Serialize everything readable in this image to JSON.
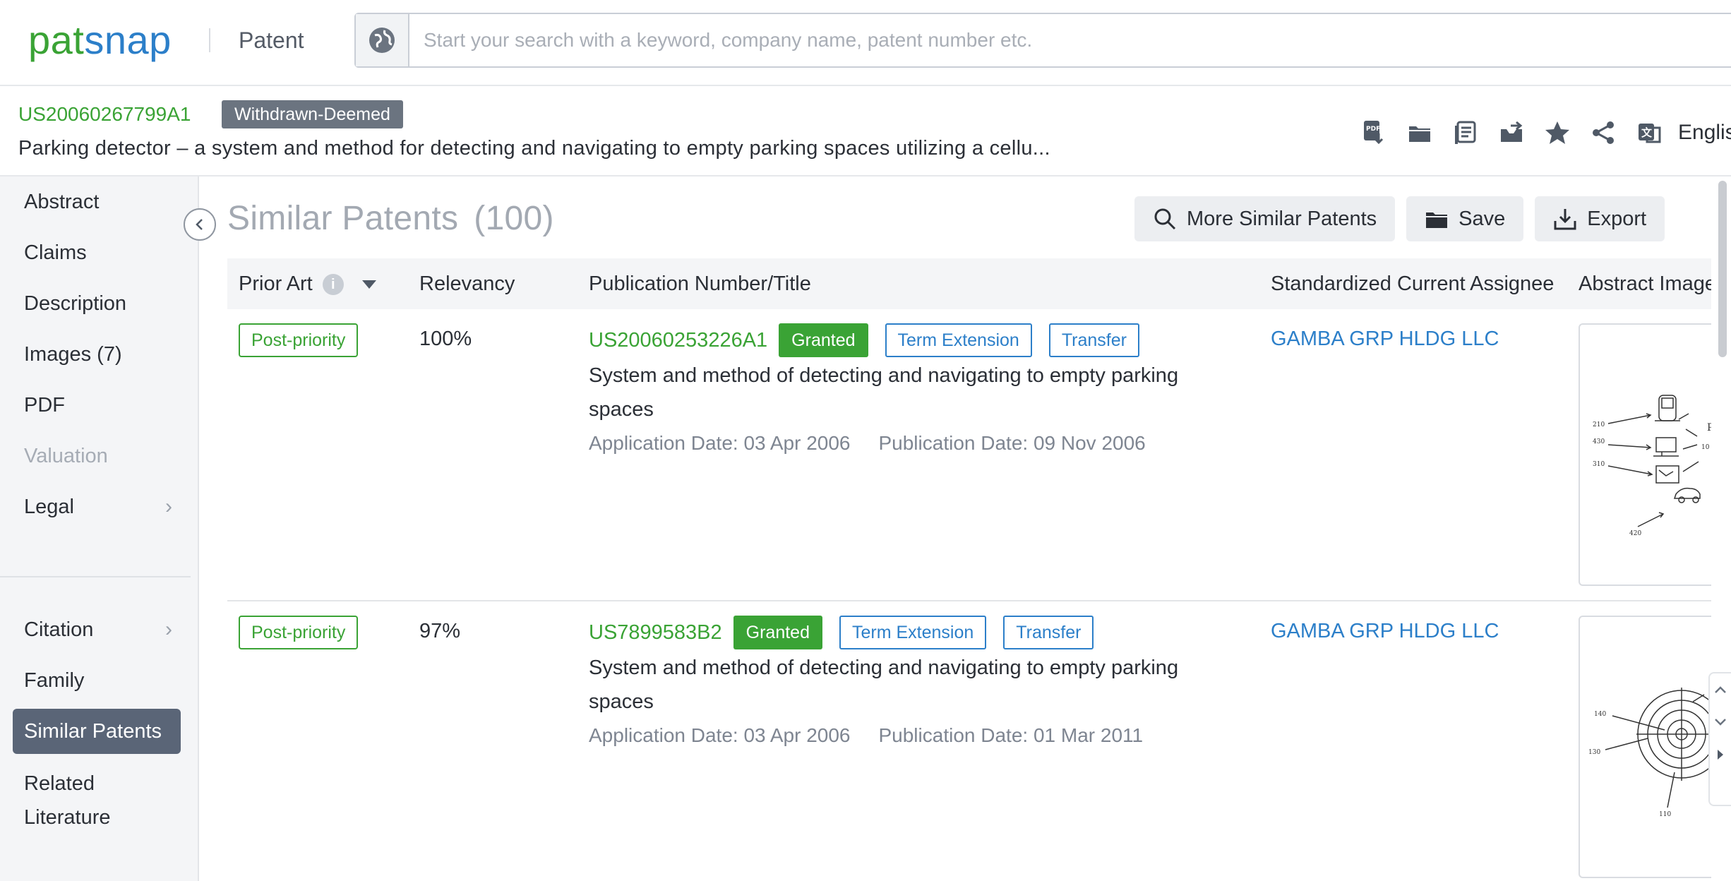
{
  "app": {
    "logo_pat": "pat",
    "logo_snap": "snap",
    "product": "Patent",
    "search_placeholder": "Start your search with a keyword, company name, patent number etc."
  },
  "patent": {
    "number": "US20060267799A1",
    "status": "Withdrawn-Deemed",
    "title": "Parking detector – a system and method for detecting and navigating to empty parking spaces utilizing a cellu...",
    "language": "English"
  },
  "toolbar_icons": [
    "pdf-download-icon",
    "folder-icon",
    "compare-icon",
    "inbox-icon",
    "star-icon",
    "share-icon",
    "translate-icon"
  ],
  "sidebar": {
    "items": [
      {
        "label": "Abstract"
      },
      {
        "label": "Claims"
      },
      {
        "label": "Description"
      },
      {
        "label": "Images (7)"
      },
      {
        "label": "PDF"
      },
      {
        "label": "Valuation"
      },
      {
        "label": "Legal"
      },
      {
        "label": "Citation"
      },
      {
        "label": "Family"
      },
      {
        "label": "Similar Patents"
      },
      {
        "label": "Related Literature"
      }
    ]
  },
  "main": {
    "title": "Similar Patents",
    "count": "(100)",
    "actions": {
      "more_similar": "More Similar Patents",
      "save": "Save",
      "export": "Export"
    },
    "columns": {
      "prior_art": "Prior Art",
      "relevancy": "Relevancy",
      "publication": "Publication Number/Title",
      "assignee": "Standardized Current Assignee",
      "abstract_image": "Abstract Image"
    },
    "rows": [
      {
        "prior_art": "Post-priority",
        "relevancy": "100%",
        "pub_no": "US20060253226A1",
        "status": "Granted",
        "tag1": "Term Extension",
        "tag2": "Transfer",
        "title": "System and method of detecting and navigating to empty parking spaces",
        "app_date": "Application Date: 03 Apr 2006",
        "pub_date": "Publication Date: 09 Nov 2006",
        "assignee": "GAMBA GRP HLDG LLC"
      },
      {
        "prior_art": "Post-priority",
        "relevancy": "97%",
        "pub_no": "US7899583B2",
        "status": "Granted",
        "tag1": "Term Extension",
        "tag2": "Transfer",
        "title": "System and method of detecting and navigating to empty parking spaces",
        "app_date": "Application Date: 03 Apr 2006",
        "pub_date": "Publication Date: 01 Mar 2011",
        "assignee": "GAMBA GRP HLDG LLC"
      }
    ]
  },
  "colors": {
    "brand_green": "#3aa335",
    "brand_blue": "#2c7fc9",
    "active_nav": "#5a6577",
    "status_gray": "#6b7480"
  }
}
